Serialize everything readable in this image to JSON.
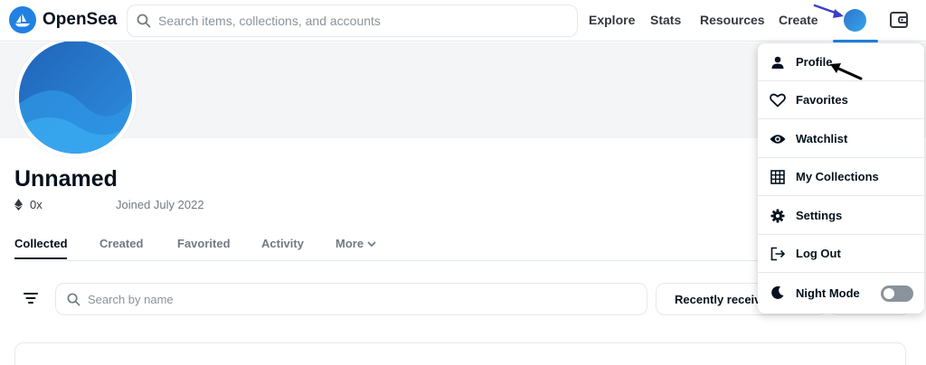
{
  "header": {
    "logo_text": "OpenSea",
    "search_placeholder": "Search items, collections, and accounts",
    "nav": {
      "explore": "Explore",
      "stats": "Stats",
      "resources": "Resources",
      "create": "Create"
    }
  },
  "profile": {
    "name": "Unnamed",
    "address": "0x",
    "joined": "Joined July 2022"
  },
  "tabs": {
    "collected": "Collected",
    "created": "Created",
    "favorited": "Favorited",
    "activity": "Activity",
    "more": "More"
  },
  "filters": {
    "search_placeholder": "Search by name",
    "sort_label": "Recently received"
  },
  "menu": {
    "items": [
      {
        "label": "Profile",
        "icon": "person-icon"
      },
      {
        "label": "Favorites",
        "icon": "heart-icon"
      },
      {
        "label": "Watchlist",
        "icon": "eye-icon"
      },
      {
        "label": "My Collections",
        "icon": "grid-icon"
      },
      {
        "label": "Settings",
        "icon": "gear-icon"
      },
      {
        "label": "Log Out",
        "icon": "logout-icon"
      },
      {
        "label": "Night Mode",
        "icon": "moon-icon"
      }
    ],
    "night_mode_on": false
  },
  "colors": {
    "brand": "#2081e2",
    "annotation_blue": "#3b3fc4",
    "annotation_black": "#000000"
  }
}
